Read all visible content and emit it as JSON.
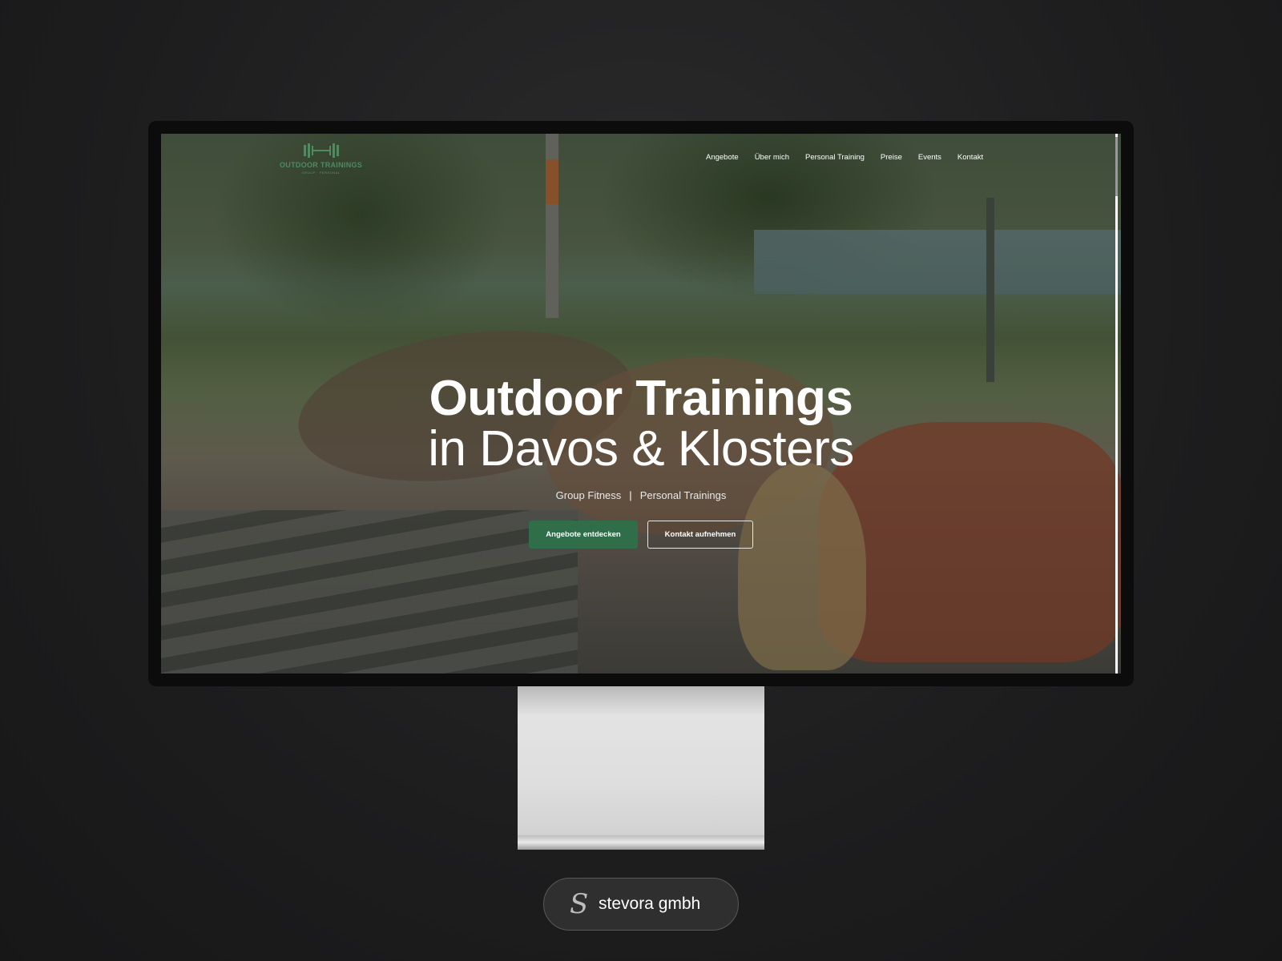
{
  "brand": {
    "logo_text": "OUTDOOR TRAININGS",
    "logo_subtitle": "GROUP · PERSONAL",
    "icon": "dumbbell-icon"
  },
  "nav": {
    "items": [
      {
        "label": "Angebote"
      },
      {
        "label": "Über mich"
      },
      {
        "label": "Personal Training"
      },
      {
        "label": "Preise"
      },
      {
        "label": "Events"
      },
      {
        "label": "Kontakt"
      }
    ]
  },
  "hero": {
    "title_line1": "Outdoor Trainings",
    "title_line2": "in Davos & Klosters",
    "subtitle_left": "Group Fitness",
    "subtitle_sep": "|",
    "subtitle_right": "Personal Trainings",
    "primary_button": "Angebote entdecken",
    "secondary_button": "Kontakt aufnehmen"
  },
  "badge": {
    "logo_glyph": "S",
    "company": "stevora gmbh"
  },
  "colors": {
    "accent_green": "#2f6e48",
    "background": "#1d1d1e"
  }
}
